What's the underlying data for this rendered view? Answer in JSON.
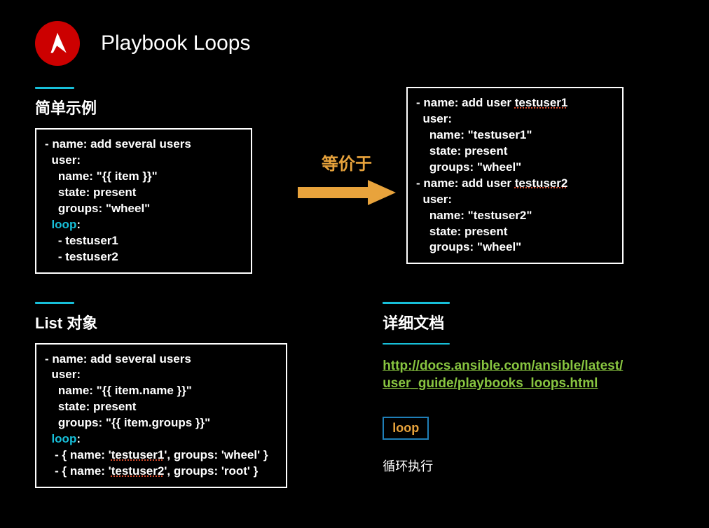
{
  "header": {
    "title": "Playbook Loops"
  },
  "section1": {
    "label": "简单示例",
    "code_left": {
      "l1": "- name: add several users",
      "l2": "  user:",
      "l3": "    name: \"{{ item }}\"",
      "l4": "    state: present",
      "l5": "    groups: \"wheel\"",
      "loop_kw": "  loop",
      "loop_colon": ":",
      "l7": "    - testuser1",
      "l8": "    - testuser2"
    },
    "equiv": "等价于",
    "code_right": {
      "l1a": "- name: add user ",
      "l1b": "testuser1",
      "l2": "  user:",
      "l3": "    name: \"testuser1\"",
      "l4": "    state: present",
      "l5": "    groups: \"wheel\"",
      "l6a": "- name: add user ",
      "l6b": "testuser2",
      "l7": "  user:",
      "l8": "    name: \"testuser2\"",
      "l9": "    state: present",
      "l10": "    groups: \"wheel\""
    }
  },
  "section2": {
    "label": "List 对象",
    "code": {
      "l1": "- name: add several users",
      "l2": "  user:",
      "l3": "    name: \"{{ item.name }}\"",
      "l4": "    state: present",
      "l5": "    groups: \"{{ item.groups }}\"",
      "loop_kw": "  loop",
      "loop_colon": ":",
      "l7a": "   - { name: '",
      "l7b": "testuser1",
      "l7c": "', groups: 'wheel' }",
      "l8a": "   - { name: '",
      "l8b": "testuser2",
      "l8c": "', groups: 'root' }"
    }
  },
  "section3": {
    "label": "详细文档",
    "link_line1": "http://docs.ansible.com/ansible/latest/",
    "link_line2": "user_guide/playbooks_loops.html",
    "badge": "loop",
    "desc": "循环执行"
  }
}
